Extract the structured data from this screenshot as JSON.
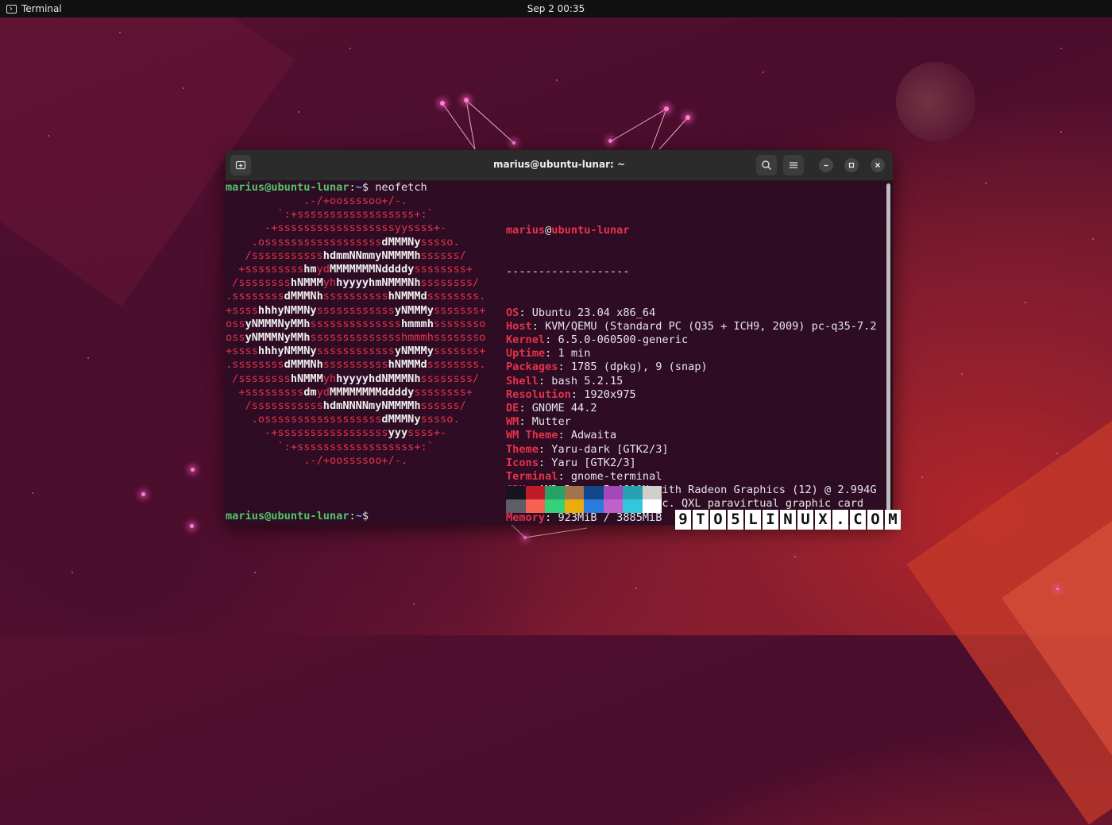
{
  "topbar": {
    "app_label": "Terminal",
    "clock": "Sep 2  00:35",
    "app_icon": "terminal-icon"
  },
  "window": {
    "title": "marius@ubuntu-lunar: ~",
    "new_tab_icon": "new-tab-icon",
    "search_icon": "search-icon",
    "menu_icon": "hamburger-menu-icon",
    "minimize_icon": "minimize-icon",
    "maximize_icon": "maximize-icon",
    "close_icon": "close-icon"
  },
  "terminal": {
    "prompt_user_host": "marius@ubuntu-lunar",
    "prompt_path": "~",
    "prompt_symbol": "$",
    "command": "neofetch",
    "logo_lines": [
      "            .-/+oossssoo+/-.",
      "        `:+ssssssssssssssssss+:`",
      "      -+ssssssssssssssssssyyssss+-",
      "    .ossssssssssssssssss|dMMMNy|sssso.",
      "   /sssssssssss|hdmmNNmmyNMMMMh|ssssss/",
      "  +sssssssss|hm|yd|MMMMMMMNddddy|ssssssss+",
      " /ssssssss|hNMMM|yh|hyyyyhmNMMMNh|ssssssss/",
      ".ssssssss|dMMMNh|ssssssssss|hNMMMd|ssssssss.",
      "+ssss|hhhyNMMNy|ssssssssssss|yNMMMy|sssssss+",
      "oss|yNMMMNyMMh|ssssssssssssss|hmmmh|ssssssso",
      "oss|yNMMMNyMMh|sssssssssssssshmmmhssssssso",
      "+ssss|hhhyNMMNy|ssssssssssss|yNMMMy|sssssss+",
      ".ssssssss|dMMMNh|ssssssssss|hNMMMd|ssssssss.",
      " /ssssssss|hNMMM|yh|hyyyyhdNMMMNh|ssssssss/",
      "  +sssssssss|dm|yd|MMMMMMMMddddy|ssssssss+",
      "   /sssssssssss|hdmNNNNmyNMMMMh|ssssss/",
      "    .ossssssssssssssssss|dMMMNy|sssso.",
      "      -+sssssssssssssssss|yyy|ssss+-",
      "        `:+ssssssssssssssssss+:`",
      "            .-/+oossssoo+/-."
    ],
    "info_user": "marius",
    "info_at": "@",
    "info_host": "ubuntu-lunar",
    "info_rule": "-------------------",
    "info": [
      {
        "key": "OS",
        "value": "Ubuntu 23.04 x86_64"
      },
      {
        "key": "Host",
        "value": "KVM/QEMU (Standard PC (Q35 + ICH9, 2009) pc-q35-7.2"
      },
      {
        "key": "Kernel",
        "value": "6.5.0-060500-generic"
      },
      {
        "key": "Uptime",
        "value": "1 min"
      },
      {
        "key": "Packages",
        "value": "1785 (dpkg), 9 (snap)"
      },
      {
        "key": "Shell",
        "value": "bash 5.2.15"
      },
      {
        "key": "Resolution",
        "value": "1920x975"
      },
      {
        "key": "DE",
        "value": "GNOME 44.2"
      },
      {
        "key": "WM",
        "value": "Mutter"
      },
      {
        "key": "WM Theme",
        "value": "Adwaita"
      },
      {
        "key": "Theme",
        "value": "Yaru-dark [GTK2/3]"
      },
      {
        "key": "Icons",
        "value": "Yaru [GTK2/3]"
      },
      {
        "key": "Terminal",
        "value": "gnome-terminal"
      },
      {
        "key": "CPU",
        "value": "AMD Ryzen 5 4600H with Radeon Graphics (12) @ 2.994G"
      },
      {
        "key": "GPU",
        "value": "00:01.0 Red Hat, Inc. QXL paravirtual graphic card"
      },
      {
        "key": "Memory",
        "value": "923MiB / 3885MiB"
      }
    ],
    "palette_row1": [
      "#171421",
      "#c01c28",
      "#26a269",
      "#a2734c",
      "#12488b",
      "#a347ba",
      "#2aa1b3",
      "#d0cfcc"
    ],
    "palette_row2": [
      "#5e5c64",
      "#f66151",
      "#33d17a",
      "#e9ad0c",
      "#2a7bde",
      "#c061cb",
      "#33c7de",
      "#ffffff"
    ]
  },
  "watermark": {
    "chars": [
      "9",
      "T",
      "O",
      "5",
      "L",
      "I",
      "N",
      "U",
      "X",
      ".",
      "C",
      "O",
      "M"
    ]
  }
}
